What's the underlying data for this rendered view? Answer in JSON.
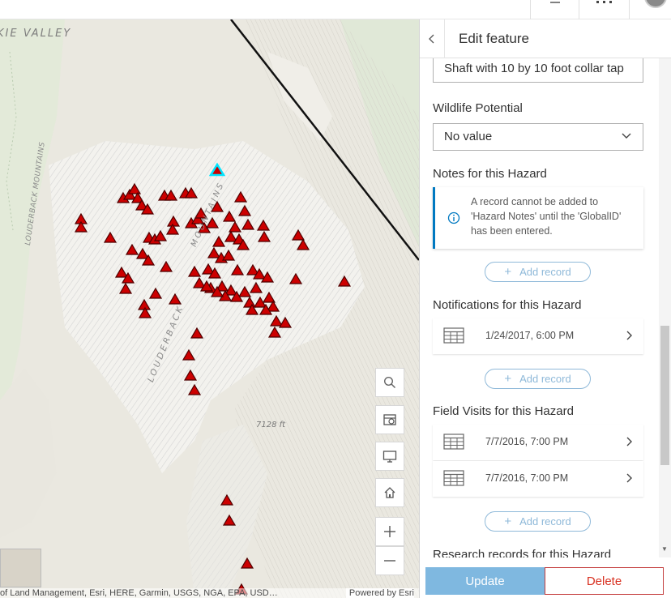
{
  "map": {
    "labels": {
      "valley": "KIE VALLEY",
      "mountains_left": "LOUDERBACK MOUNTAINS",
      "mountains_mid": "LOUDERBACK",
      "mountains_top": "MOUNTAINS",
      "elevation": "7128 ft"
    },
    "controls": {
      "search": "search-icon",
      "locate": "locate-icon",
      "display": "monitor-icon",
      "home": "home-icon",
      "zoom_in": "+",
      "zoom_out": "—"
    },
    "attribution": "of Land Management, Esri, HERE, Garmin, USGS, NGA, EPA, USD…",
    "powered_by": "Powered by Esri",
    "colors": {
      "hazard_marker": "#cc0000",
      "selected_marker": "#00e5ff",
      "boundary_line": "#111111"
    }
  },
  "panel": {
    "title": "Edit feature",
    "fields": {
      "shaft_value": "Shaft with 10 by 10 foot collar tap",
      "wildlife_label": "Wildlife Potential",
      "wildlife_value": "No value",
      "notes_label": "Notes for this Hazard",
      "notes_notice": "A record cannot be added to 'Hazard Notes' until the 'GlobalID' has been entered.",
      "notifications_label": "Notifications for this Hazard",
      "field_visits_label": "Field Visits for this Hazard",
      "research_label": "Research records for this Hazard"
    },
    "add_record_label": "Add record",
    "notifications": [
      {
        "date": "1/24/2017, 6:00 PM"
      }
    ],
    "field_visits": [
      {
        "date": "7/7/2016, 7:00 PM"
      },
      {
        "date": "7/7/2016, 7:00 PM"
      }
    ],
    "update_label": "Update",
    "delete_label": "Delete",
    "colors": {
      "accent": "#0079c1",
      "update_bg": "#7fb8e0",
      "delete": "#d83020"
    }
  }
}
